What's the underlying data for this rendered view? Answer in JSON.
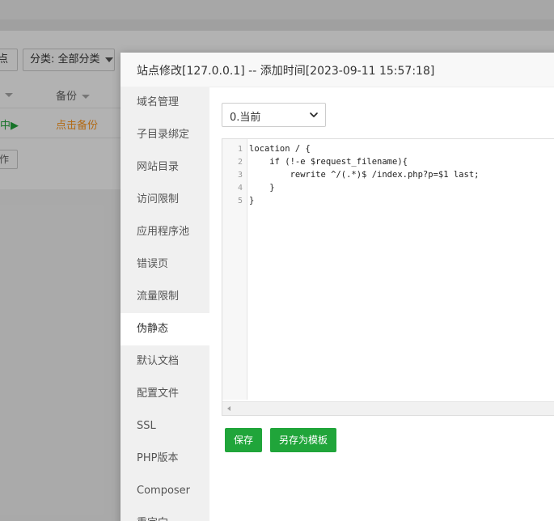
{
  "background": {
    "site_button_label": "点",
    "category_label": "分类: 全部分类",
    "table": {
      "backup_header": "备份"
    },
    "row": {
      "status": "中▶",
      "backup_link": "点击备份"
    },
    "op_button_label": "作"
  },
  "dialog": {
    "title": "站点修改[127.0.0.1] -- 添加时间[2023-09-11 15:57:18]",
    "sidebar_items": [
      {
        "label": "域名管理"
      },
      {
        "label": "子目录绑定"
      },
      {
        "label": "网站目录"
      },
      {
        "label": "访问限制"
      },
      {
        "label": "应用程序池"
      },
      {
        "label": "错误页"
      },
      {
        "label": "流量限制"
      },
      {
        "label": "伪静态",
        "active": true
      },
      {
        "label": "默认文档"
      },
      {
        "label": "配置文件"
      },
      {
        "label": "SSL"
      },
      {
        "label": "PHP版本"
      },
      {
        "label": "Composer"
      },
      {
        "label": "重定向"
      }
    ],
    "version_select": {
      "selected": "0.当前"
    },
    "editor": {
      "line_numbers": [
        "1",
        "2",
        "3",
        "4",
        "5"
      ],
      "lines": [
        "location / {",
        "    if (!-e $request_filename){",
        "        rewrite ^/(.*)$ /index.php?p=$1 last;",
        "    }",
        "}"
      ]
    },
    "buttons": {
      "save": "保存",
      "save_as_template": "另存为模板"
    }
  },
  "colors": {
    "accent_green": "#20a53a",
    "backup_orange": "#ff9a22"
  }
}
